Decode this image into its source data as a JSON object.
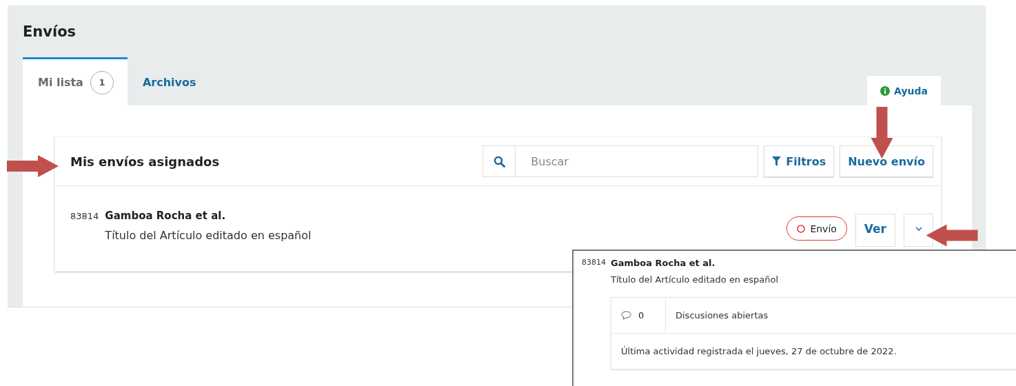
{
  "page_title": "Envíos",
  "tabs": [
    {
      "label": "Mi lista",
      "count": "1",
      "selected": true
    },
    {
      "label": "Archivos",
      "selected": false
    }
  ],
  "help_tab": {
    "label": "Ayuda"
  },
  "list": {
    "title": "Mis envíos asignados",
    "search": {
      "placeholder": "Buscar"
    },
    "buttons": [
      {
        "label": "Filtros",
        "kind": "filter"
      },
      {
        "label": "Nuevo envío",
        "kind": "plain"
      }
    ],
    "items": [
      {
        "id": "83814",
        "authors": "Gamboa Rocha et al.",
        "title": "Título del Artículo editado en español",
        "stage": "Envío",
        "view": "Ver"
      }
    ]
  },
  "detail_popup": {
    "id": "83814",
    "authors": "Gamboa Rocha et al.",
    "title": "Título del Artículo editado en español",
    "discussions_count": "0",
    "discussions_label": "Discusiones abiertas",
    "last_activity": "Última actividad registrada el jueves, 27 de octubre de 2022."
  }
}
